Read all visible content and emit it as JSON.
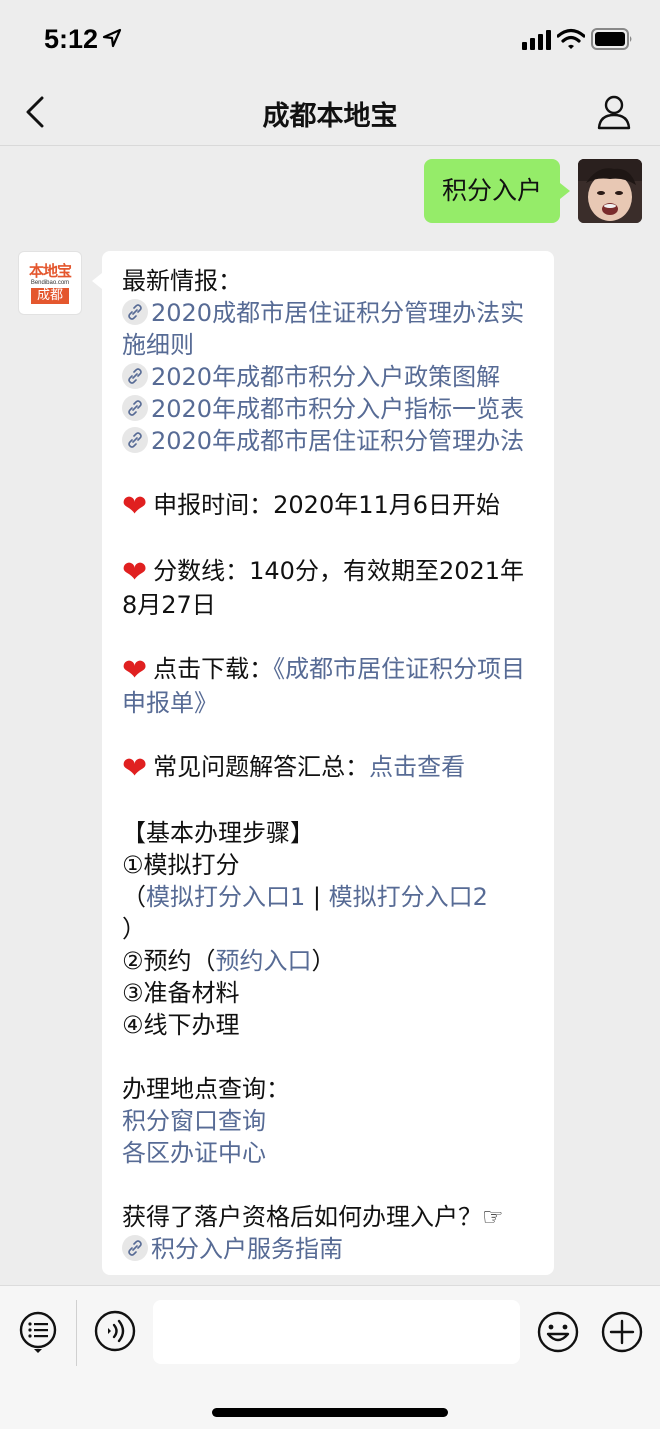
{
  "status_bar": {
    "time": "5:12"
  },
  "nav": {
    "title": "成都本地宝"
  },
  "chat": {
    "user_message": "积分入户",
    "bot_logo": {
      "top": "本地宝",
      "mid": "Bendibao.com",
      "bottom": "成都"
    },
    "bot_lines": [
      {
        "type": "text",
        "text": "最新情报："
      },
      {
        "type": "link_icon",
        "text": "2020成都市居住证积分管理办法实施细则"
      },
      {
        "type": "link_icon",
        "text": "2020年成都市积分入户政策图解"
      },
      {
        "type": "link_icon",
        "text": "2020年成都市积分入户指标一览表"
      },
      {
        "type": "link_icon",
        "text": "2020年成都市居住证积分管理办法"
      },
      {
        "type": "heart",
        "label": "申报时间：",
        "text": "2020年11月6日开始"
      },
      {
        "type": "heart",
        "label": "分数线：",
        "text": "140分，有效期至2021年8月27日"
      },
      {
        "type": "heart",
        "label": "点击下载：",
        "link": "《成都市居住证积分项目申报单》"
      },
      {
        "type": "heart",
        "label": "常见问题解答汇总：",
        "link": "点击查看"
      },
      {
        "type": "text",
        "text": "【基本办理步骤】"
      },
      {
        "type": "text",
        "text": "①模拟打分"
      },
      {
        "type": "links",
        "prefix": "（",
        "link1": "模拟打分入口1",
        "sep": " | ",
        "link2": "模拟打分入口2",
        "suffix": "）"
      },
      {
        "type": "text",
        "text": "②预约（",
        "link": "预约入口",
        "suffix": "）"
      },
      {
        "type": "text",
        "text": "③准备材料"
      },
      {
        "type": "text",
        "text": "④线下办理"
      },
      {
        "type": "text",
        "text": "办理地点查询："
      },
      {
        "type": "link",
        "text": "积分窗口查询"
      },
      {
        "type": "link",
        "text": "各区办证中心"
      },
      {
        "type": "text",
        "text": "获得了落户资格后如何办理入户？☞"
      },
      {
        "type": "link_icon",
        "text": "积分入户服务指南"
      }
    ]
  },
  "icons": {
    "back": "chevron-left-icon",
    "profile": "person-icon",
    "menu": "list-icon",
    "voice": "voice-icon",
    "emoji": "smile-icon",
    "plus": "plus-icon"
  },
  "colors": {
    "link": "#576b95",
    "my_bubble": "#95ec69",
    "heart": "#e02020"
  }
}
